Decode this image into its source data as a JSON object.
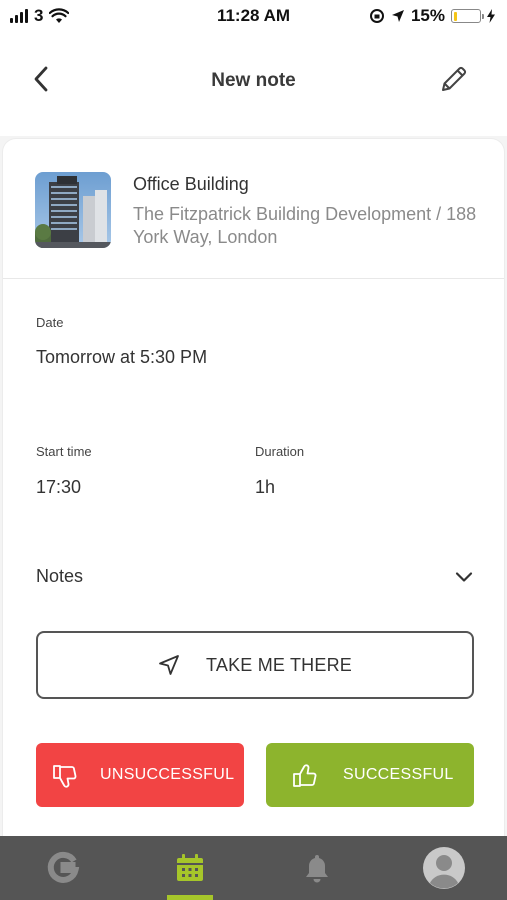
{
  "status_bar": {
    "carrier": "3",
    "time": "11:28 AM",
    "battery_percent": "15%",
    "battery_level": 0.15
  },
  "header": {
    "title": "New note",
    "back_icon": "chevron-left-icon",
    "edit_icon": "pencil-icon"
  },
  "property": {
    "title": "Office Building",
    "address": "The Fitzpatrick Building Development / 188 York Way, London"
  },
  "fields": {
    "date_label": "Date",
    "date_value": "Tomorrow at 5:30 PM",
    "start_label": "Start time",
    "start_value": "17:30",
    "duration_label": "Duration",
    "duration_value": "1h"
  },
  "notes": {
    "label": "Notes",
    "expanded": false
  },
  "actions": {
    "take_me_there": "TAKE ME THERE",
    "unsuccessful": "UNSUCCESSFUL",
    "successful": "SUCCESSFUL"
  },
  "tab_bar": {
    "tabs": [
      {
        "icon": "logo-g-icon",
        "active": false
      },
      {
        "icon": "calendar-icon",
        "active": true
      },
      {
        "icon": "bell-icon",
        "active": false
      },
      {
        "icon": "avatar-icon",
        "active": false
      }
    ]
  },
  "colors": {
    "danger": "#f24444",
    "success": "#8db42d",
    "tab_active": "#a6c62a",
    "tab_bar": "#555555"
  }
}
